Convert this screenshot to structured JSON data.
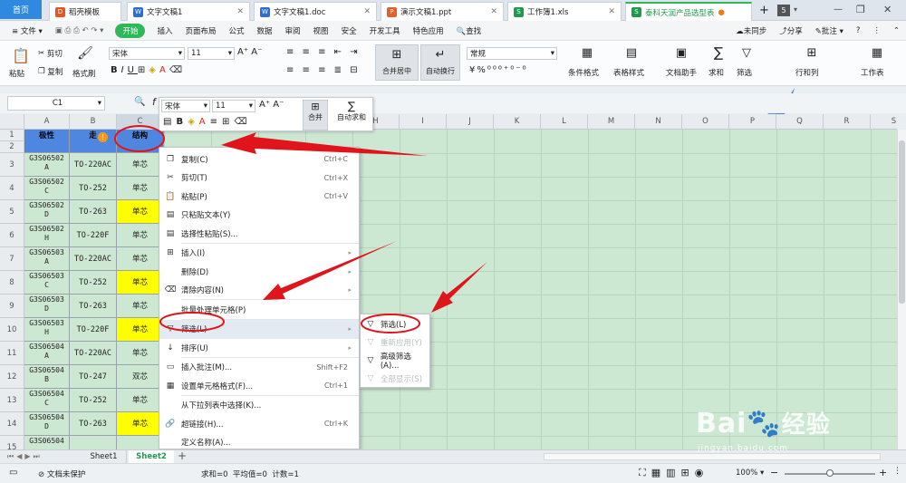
{
  "tabs": {
    "home": "首页",
    "docs": [
      {
        "label": "稻壳模板",
        "icon_text": "D",
        "color": "#e8541e"
      },
      {
        "label": "文字文稿1",
        "icon_text": "W",
        "color": "#2b6fd3"
      },
      {
        "label": "文字文稿1.doc",
        "icon_text": "W",
        "color": "#2b6fd3"
      },
      {
        "label": "演示文稿1.ppt",
        "icon_text": "P",
        "color": "#e5602c"
      },
      {
        "label": "工作簿1.xls",
        "icon_text": "S",
        "color": "#1f9a4e"
      },
      {
        "label": "泰科天润产品选型表",
        "icon_text": "S",
        "color": "#1f9a4e"
      }
    ],
    "add": "+",
    "count": "5"
  },
  "menubar": {
    "file": "≡ 文件 ▾",
    "items": [
      "开始",
      "插入",
      "页面布局",
      "公式",
      "数据",
      "审阅",
      "视图",
      "安全",
      "开发工具",
      "特色应用"
    ],
    "search": "查找",
    "sync": "未同步",
    "share": "分享",
    "comment": "批注",
    "help": "?"
  },
  "ribbon": {
    "paste": "粘贴",
    "cut": "剪切",
    "copy": "复制",
    "format_painter": "格式刷",
    "font_name": "宋体",
    "font_size": "11",
    "merge": "合并居中",
    "wrap": "自动换行",
    "number_format": "常规",
    "percent": "%",
    "conditional": "条件格式",
    "table_style": "表格样式",
    "doc_helper": "文档助手",
    "sum": "求和",
    "filter": "筛选",
    "rowcol": "行和列",
    "worksheet": "工作表"
  },
  "formula_bar": {
    "cell_ref": "C1",
    "fx": "f"
  },
  "mini_toolbar": {
    "font_name": "宋体",
    "font_size": "11",
    "merge": "合并",
    "autosum": "自动求和"
  },
  "columns": [
    "A",
    "B",
    "C",
    "D",
    "E",
    "F",
    "G",
    "H",
    "I",
    "J",
    "K",
    "L",
    "M",
    "N",
    "O",
    "P",
    "Q",
    "R",
    "S"
  ],
  "header_row": {
    "a": "极性",
    "b": "走",
    "c": "结构"
  },
  "rows": [
    {
      "n": "3",
      "a": "G3S06502\nA",
      "b": "TO-220AC",
      "c": "单芯",
      "yellow": false
    },
    {
      "n": "4",
      "a": "G3S06502\nC",
      "b": "TO-252",
      "c": "单芯",
      "yellow": false
    },
    {
      "n": "5",
      "a": "G3S06502\nD",
      "b": "TO-263",
      "c": "单芯",
      "yellow": true
    },
    {
      "n": "6",
      "a": "G3S06502\nH",
      "b": "TO-220F",
      "c": "单芯",
      "yellow": false
    },
    {
      "n": "7",
      "a": "G3S06503\nA",
      "b": "TO-220AC",
      "c": "单芯",
      "yellow": false
    },
    {
      "n": "8",
      "a": "G3S06503\nC",
      "b": "TO-252",
      "c": "单芯",
      "yellow": true
    },
    {
      "n": "9",
      "a": "G3S06503\nD",
      "b": "TO-263",
      "c": "单芯",
      "yellow": false
    },
    {
      "n": "10",
      "a": "G3S06503\nH",
      "b": "TO-220F",
      "c": "单芯",
      "yellow": true
    },
    {
      "n": "11",
      "a": "G3S06504\nA",
      "b": "TO-220AC",
      "c": "单芯",
      "yellow": false
    },
    {
      "n": "12",
      "a": "G3S06504\nB",
      "b": "TO-247",
      "c": "双芯",
      "yellow": false
    },
    {
      "n": "13",
      "a": "G3S06504\nC",
      "b": "TO-252",
      "c": "单芯",
      "yellow": false
    },
    {
      "n": "14",
      "a": "G3S06504\nD",
      "b": "TO-263",
      "c": "单芯",
      "yellow": true
    },
    {
      "n": "15",
      "a": "G3S06504",
      "b": "",
      "c": "",
      "yellow": false
    }
  ],
  "context_menu": [
    {
      "label": "复制(C)",
      "shortcut": "Ctrl+C",
      "icon": "copy-icon",
      "glyph": "❐"
    },
    {
      "label": "剪切(T)",
      "shortcut": "Ctrl+X",
      "icon": "scissors-icon",
      "glyph": "✂"
    },
    {
      "label": "粘贴(P)",
      "shortcut": "Ctrl+V",
      "icon": "paste-icon",
      "glyph": "📋"
    },
    {
      "label": "只粘贴文本(Y)",
      "shortcut": "",
      "icon": "paste-text-icon",
      "glyph": "▤"
    },
    {
      "label": "选择性粘贴(S)...",
      "shortcut": "",
      "icon": "paste-special-icon",
      "glyph": "▤"
    },
    {
      "label": "插入(I)",
      "shortcut": "",
      "icon": "insert-icon",
      "glyph": "⊞",
      "submenu": true
    },
    {
      "label": "删除(D)",
      "shortcut": "",
      "icon": "",
      "glyph": "",
      "submenu": true
    },
    {
      "label": "清除内容(N)",
      "shortcut": "",
      "icon": "eraser-icon",
      "glyph": "⌫",
      "submenu": true
    },
    {
      "label": "批量处理单元格(P)",
      "shortcut": "",
      "icon": "",
      "glyph": ""
    },
    {
      "label": "筛选(L)",
      "shortcut": "",
      "icon": "filter-icon",
      "glyph": "▽",
      "submenu": true,
      "active": true
    },
    {
      "label": "排序(U)",
      "shortcut": "",
      "icon": "sort-icon",
      "glyph": "↓",
      "submenu": true
    },
    {
      "label": "插入批注(M)...",
      "shortcut": "Shift+F2",
      "icon": "comment-icon",
      "glyph": "▭"
    },
    {
      "label": "设置单元格格式(F)...",
      "shortcut": "Ctrl+1",
      "icon": "format-cells-icon",
      "glyph": "▦"
    },
    {
      "label": "从下拉列表中选择(K)...",
      "shortcut": "",
      "icon": "",
      "glyph": ""
    },
    {
      "label": "超链接(H)...",
      "shortcut": "Ctrl+K",
      "icon": "link-icon",
      "glyph": "🔗"
    },
    {
      "label": "定义名称(A)...",
      "shortcut": "",
      "icon": "",
      "glyph": ""
    }
  ],
  "filter_submenu": [
    {
      "label": "筛选(L)",
      "enabled": true,
      "glyph": "▽"
    },
    {
      "label": "重新应用(Y)",
      "enabled": false,
      "glyph": "▽"
    },
    {
      "label": "高级筛选(A)...",
      "enabled": true,
      "glyph": "▽"
    },
    {
      "label": "全部显示(S)",
      "enabled": false,
      "glyph": "▽"
    }
  ],
  "sheets": {
    "sheet1": "Sheet1",
    "sheet2": "Sheet2",
    "add": "+"
  },
  "status": {
    "protect": "文档未保护",
    "stats": "求和=0  平均值=0  计数=1",
    "zoom": "100%"
  },
  "watermark": {
    "brand": "Bai",
    "suffix": "经验",
    "url": "jingyan.baidu.com"
  },
  "colors": {
    "accent": "#2f89e0",
    "green": "#2fb75a",
    "header_blue": "#4f86e0",
    "annotation_red": "#e0151c",
    "cell_yellow": "#ffff00"
  }
}
